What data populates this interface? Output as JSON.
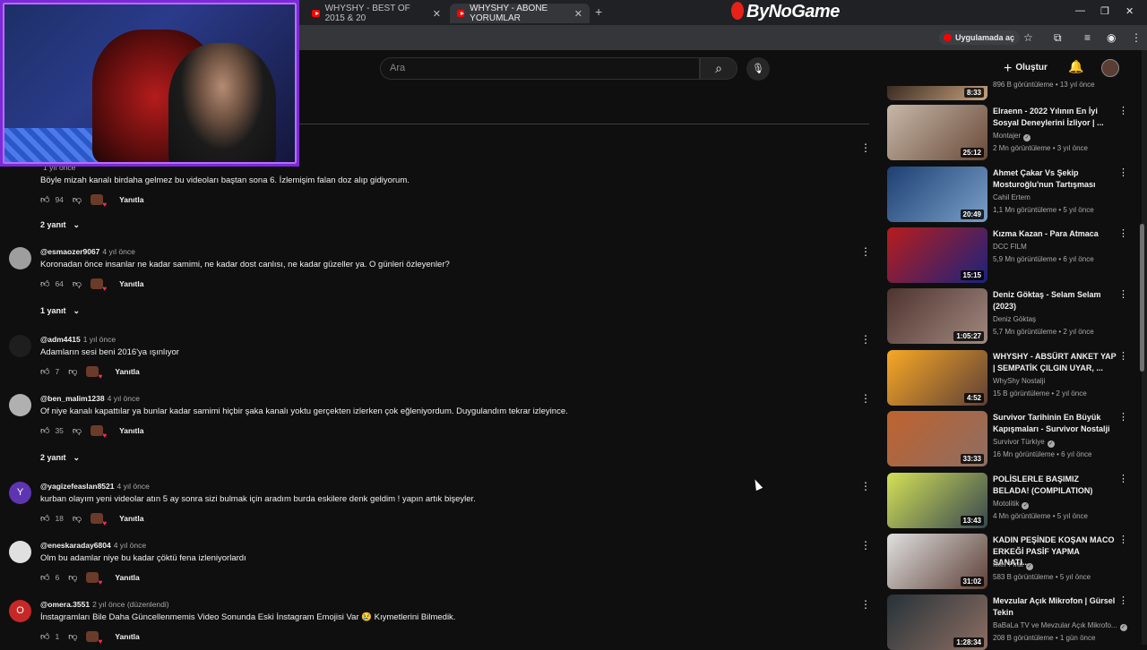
{
  "browser": {
    "tabs": [
      {
        "label": "WHYSHY - BEST OF 2015 & 20",
        "active": false
      },
      {
        "label": "WHYSHY - ABONE YORUMLAR",
        "active": true
      }
    ],
    "brand": "ByNoGame",
    "open_in_app": "Uygulamada aç",
    "window_controls": [
      "—",
      "❐",
      "✕"
    ]
  },
  "youtube": {
    "search_placeholder": "Ara",
    "create_label": "Oluştur"
  },
  "comments": [
    {
      "user": "",
      "when": "1 yıl önce",
      "text": "Böyle mizah kanalı birdaha gelmez bu videoları baştan sona 6. İzlemişim falan doz alıp gidiyorum.",
      "likes": "94",
      "reply": "Yanıtla",
      "replies": "2 yanıt",
      "avatar_color": "#0f0f0f",
      "avatar_letter": ""
    },
    {
      "user": "@esmaozer9067",
      "when": "4 yıl önce",
      "text": "Koronadan önce insanlar ne kadar samimi, ne kadar dost canlısı, ne kadar güzeller ya. O günleri özleyenler?",
      "likes": "64",
      "reply": "Yanıtla",
      "replies": "1 yanıt",
      "avatar_color": "#9e9e9e",
      "avatar_letter": ""
    },
    {
      "user": "@adm4415",
      "when": "1 yıl önce",
      "text": "Adamların sesi beni 2016'ya ışınlıyor",
      "likes": "7",
      "reply": "Yanıtla",
      "replies": "",
      "avatar_color": "#1e1e1e",
      "avatar_letter": ""
    },
    {
      "user": "@ben_malim1238",
      "when": "4 yıl önce",
      "text": "Of niye kanalı kapattılar ya bunlar kadar samimi hiçbir şaka kanalı yoktu gerçekten izlerken çok eğleniyordum. Duygulandım tekrar izleyince.",
      "likes": "35",
      "reply": "Yanıtla",
      "replies": "2 yanıt",
      "avatar_color": "#b0b0b0",
      "avatar_letter": ""
    },
    {
      "user": "@yagizefeaslan8521",
      "when": "4 yıl önce",
      "text": "kurban olayım yeni videolar atın 5 ay sonra sizi bulmak için aradım burda eskilere denk geldim ! yapın artık bişeyler.",
      "likes": "18",
      "reply": "Yanıtla",
      "replies": "",
      "avatar_color": "#5e35b1",
      "avatar_letter": "Y"
    },
    {
      "user": "@eneskaraday6804",
      "when": "4 yıl önce",
      "text": "Olm bu adamlar niye bu kadar çöktü fena izleniyorlardı",
      "likes": "6",
      "reply": "Yanıtla",
      "replies": "",
      "avatar_color": "#e0e0e0",
      "avatar_letter": ""
    },
    {
      "user": "@omera.3551",
      "when": "2 yıl önce (düzenlendi)",
      "text": "İnstagramları Bile Daha Güncellenmemis Video Sonunda Eski İnstagram Emojisi Var 😢 Kıymetlerini Bilmedik.",
      "likes": "1",
      "reply": "Yanıtla",
      "replies": "",
      "avatar_color": "#c62828",
      "avatar_letter": "O"
    }
  ],
  "rail": [
    {
      "title": "",
      "channel": "",
      "meta": "896 B görüntüleme • 13 yıl önce",
      "duration": "8:33",
      "verified": false,
      "thumb": [
        "#3a2c22",
        "#c9a27e"
      ]
    },
    {
      "title": "Elraenn - 2022 Yılının En İyi Sosyal Deneylerini İzliyor | ...",
      "channel": "Montajer",
      "meta": "2 Mn görüntüleme • 3 yıl önce",
      "duration": "25:12",
      "verified": true,
      "thumb": [
        "#c7b8a8",
        "#6a4a3a"
      ]
    },
    {
      "title": "Ahmet Çakar Vs Şekip Mosturoğlu'nun Tartışması",
      "channel": "Cahil Ertem",
      "meta": "1,1 Mn görüntüleme • 5 yıl önce",
      "duration": "20:49",
      "verified": false,
      "thumb": [
        "#1d3f73",
        "#7aa0c8"
      ]
    },
    {
      "title": "Kızma Kazan - Para Atmaca",
      "channel": "DCC FILM",
      "meta": "5,9 Mn görüntüleme • 6 yıl önce",
      "duration": "15:15",
      "verified": false,
      "thumb": [
        "#b71c1c",
        "#1a237e"
      ]
    },
    {
      "title": "Deniz Göktaş - Selam Selam (2023)",
      "channel": "Deniz Göktaş",
      "meta": "5,7 Mn görüntüleme • 2 yıl önce",
      "duration": "1:05:27",
      "verified": false,
      "thumb": [
        "#4e342e",
        "#a1887f"
      ]
    },
    {
      "title": "WHYSHY - ABSÜRT ANKET YAP | SEMPATİK ÇILGIN UYAR, ...",
      "channel": "WhyShy Nostalji",
      "meta": "15 B görüntüleme • 2 yıl önce",
      "duration": "4:52",
      "verified": false,
      "thumb": [
        "#f9a825",
        "#5d4037"
      ]
    },
    {
      "title": "Survivor Tarihinin En Büyük Kapışmaları - Survivor Nostalji",
      "channel": "Survivor Türkiye",
      "meta": "16 Mn görüntüleme • 6 yıl önce",
      "duration": "33:33",
      "verified": true,
      "thumb": [
        "#c0622e",
        "#8d6e63"
      ]
    },
    {
      "title": "POLİSLERLE BAŞIMIZ BELADA! (COMPILATION)",
      "channel": "Motolitik",
      "meta": "4 Mn görüntüleme • 5 yıl önce",
      "duration": "13:43",
      "verified": true,
      "thumb": [
        "#d4e157",
        "#37474f"
      ]
    },
    {
      "title": "KADIN PEŞİNDE KOŞAN MACO ERKEĞİ PASİF YAPMA SANATI...",
      "channel": "İlker Fırat",
      "meta": "583 B görüntüleme • 5 yıl önce",
      "duration": "31:02",
      "verified": true,
      "thumb": [
        "#e0e0e0",
        "#5d4037"
      ]
    },
    {
      "title": "Mevzular Açık Mikrofon | Gürsel Tekin",
      "channel": "BaBaLa TV ve Mevzular Açık Mikrofo...",
      "meta": "208 B görüntüleme • 1 gün önce",
      "duration": "1:28:34",
      "verified": true,
      "thumb": [
        "#263238",
        "#8d6e63"
      ]
    }
  ]
}
